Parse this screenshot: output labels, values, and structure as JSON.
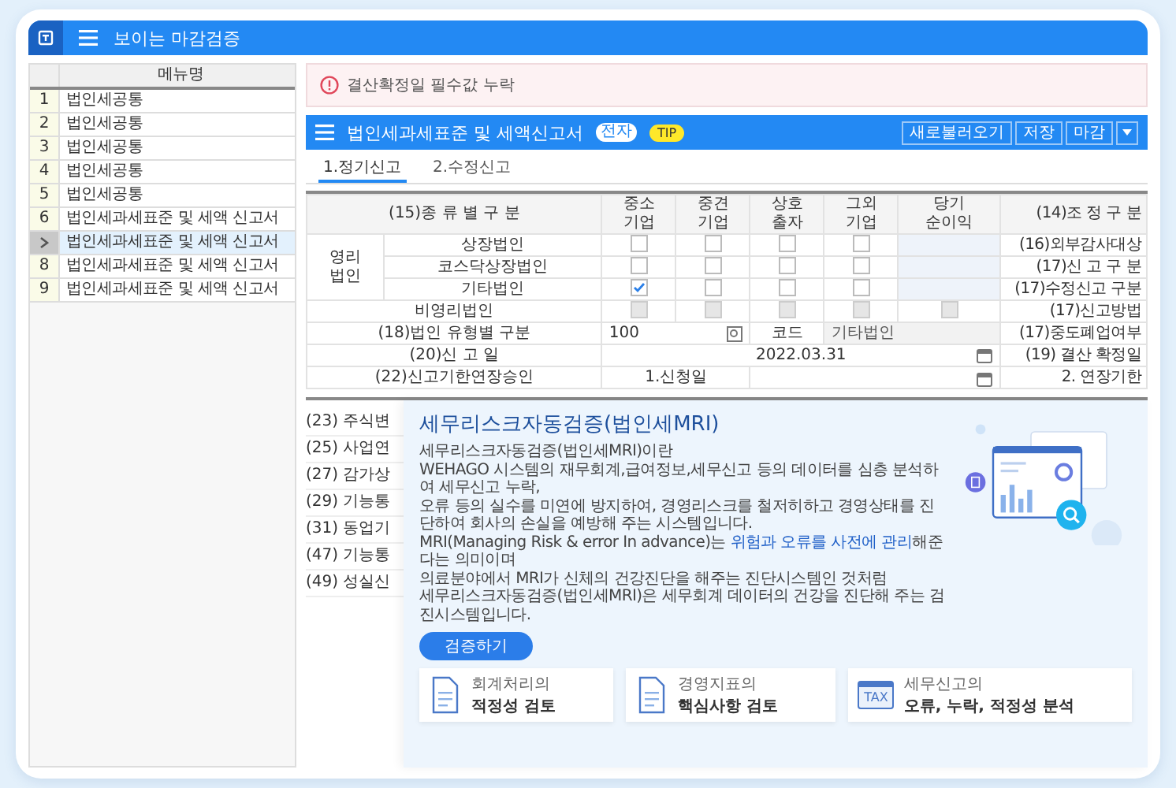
{
  "app": {
    "title": "보이는 마감검증"
  },
  "menu_table": {
    "header": "메뉴명",
    "rows": [
      {
        "no": "1",
        "name": "법인세공통",
        "selected": false
      },
      {
        "no": "2",
        "name": "법인세공통",
        "selected": false
      },
      {
        "no": "3",
        "name": "법인세공통",
        "selected": false
      },
      {
        "no": "4",
        "name": "법인세공통",
        "selected": false
      },
      {
        "no": "5",
        "name": "법인세공통",
        "selected": false
      },
      {
        "no": "6",
        "name": "법인세과세표준 및 세액 신고서",
        "selected": false
      },
      {
        "name": "법인세과세표준 및 세액 신고서",
        "selected": true
      },
      {
        "no": "8",
        "name": "법인세과세표준 및 세액 신고서",
        "selected": false
      },
      {
        "no": "9",
        "name": "법인세과세표준 및 세액 신고서",
        "selected": false
      }
    ]
  },
  "alert": {
    "message": "결산확정일 필수값 누락"
  },
  "form_header": {
    "title": "법인세과세표준 및 세액신고서",
    "badge": "전자",
    "tip": "TIP",
    "buttons": [
      "새로불러오기",
      "저장",
      "마감"
    ]
  },
  "tabs": [
    {
      "label": "1.정기신고",
      "selected": true
    },
    {
      "label": "2.수정신고",
      "selected": false
    }
  ],
  "form": {
    "type_label": "(15)종 류 별 구 분",
    "columns": [
      "중소\n기업",
      "중견\n기업",
      "상호\n출자",
      "그외\n기업",
      "당기\n순이익"
    ],
    "adjust_label": "(14)조 정 구 분",
    "for_profit": {
      "label": "영리\n법인",
      "rows": [
        {
          "label": "상장법인",
          "checks": [
            {
              "checked": false
            },
            {
              "checked": false
            },
            {
              "checked": false
            },
            {
              "checked": false
            }
          ],
          "side": "(16)외부감사대상"
        },
        {
          "label": "코스닥상장법인",
          "checks": [
            {
              "checked": false
            },
            {
              "checked": false
            },
            {
              "checked": false
            },
            {
              "checked": false
            }
          ],
          "side": "(17)신 고 구 분"
        },
        {
          "label": "기타법인",
          "checks": [
            {
              "checked": true
            },
            {
              "checked": false
            },
            {
              "checked": false
            },
            {
              "checked": false
            }
          ],
          "side": "(17)수정신고 구분"
        }
      ]
    },
    "non_profit": {
      "label": "비영리법인",
      "checks": [
        {
          "checked": false,
          "disabled": true
        },
        {
          "checked": false,
          "disabled": true
        },
        {
          "checked": false,
          "disabled": true
        },
        {
          "checked": false,
          "disabled": true
        },
        {
          "checked": false,
          "disabled": true
        }
      ],
      "side": "(17)신고방법"
    },
    "type_row": {
      "label": "(18)법인 유형별 구분",
      "value": "100",
      "code_label": "코드",
      "code_value": "기타법인",
      "side": "(17)중도폐업여부"
    },
    "date_row": {
      "label": "(20)신 고 일",
      "value": "2022.03.31",
      "side": "(19) 결산 확정일"
    },
    "ext_row": {
      "label": "(22)신고기한연장승인",
      "option": "1.신청일",
      "side": "2. 연장기한"
    }
  },
  "side_list": [
    "(23) 주식변",
    "(25) 사업연",
    "(27) 감가상",
    "(29) 기능통",
    "(31) 동업기",
    "(47) 기능통",
    "(49) 성실신"
  ],
  "mri": {
    "title": "세무리스크자동검증(법인세MRI)",
    "lines": [
      "세무리스크자동검증(법인세MRI)이란",
      "WEHAGO 시스템의 재무회계,급여정보,세무신고 등의 데이터를 심층 분석하여 세무신고 누락,",
      "오류 등의 실수를 미연에 방지하여, 경영리스크를 철저히하고 경영상태를 진단하여 회사의 손실을 예방해 주는 시스템입니다.",
      "MRI(Managing Risk & error In advance)는 **위험과 오류를 사전에 관리**해준다는 의미이며",
      "의료분야에서 MRI가 신체의 건강진단을 해주는 진단시스템인 것처럼",
      "세무리스크자동검증(법인세MRI)은 세무회계 데이터의 건강을 진단해 주는 검진시스템입니다."
    ],
    "button": "검증하기",
    "cards": [
      {
        "kind": "doc",
        "line1": "회계처리의",
        "line2": "적정성 검토"
      },
      {
        "kind": "doc",
        "line1": "경영지표의",
        "line2": "핵심사항 검토"
      },
      {
        "kind": "tax",
        "icon_text": "TAX",
        "line1": "세무신고의",
        "line2": "오류, 누락, 적정성 분석"
      }
    ]
  }
}
